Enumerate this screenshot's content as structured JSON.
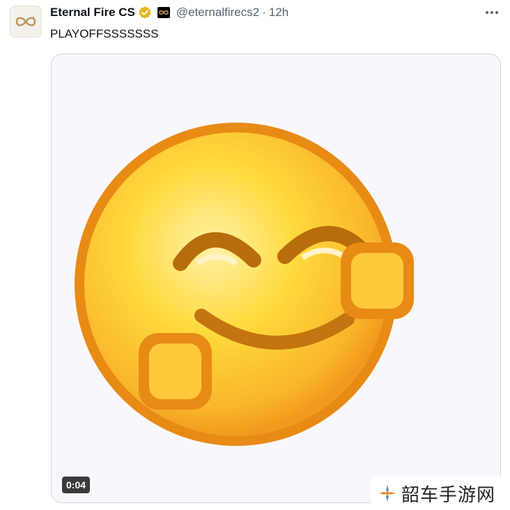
{
  "tweet": {
    "display_name": "Eternal Fire CS",
    "handle": "@eternalfirecs2",
    "separator": "·",
    "time": "12h",
    "text": "PLAYOFFSSSSSSS",
    "video_duration": "0:04"
  },
  "icons": {
    "avatar": "eternal-fire-logo",
    "verified": "gold-verified-badge-icon",
    "affiliate": "affiliate-badge-icon",
    "more": "more-options-icon"
  },
  "colors": {
    "verified_gold": "#e2b719",
    "emoji_yellow": "#ffd93b",
    "emoji_orange": "#f19a1e",
    "emoji_outline": "#e88b15"
  },
  "watermark": {
    "text": "韶车手游网"
  }
}
